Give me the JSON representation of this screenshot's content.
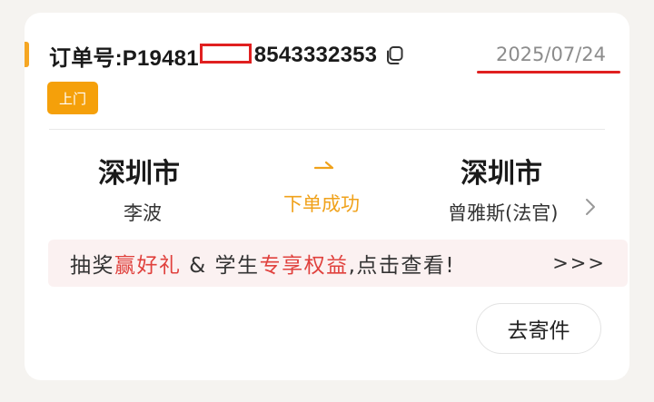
{
  "order": {
    "label_prefix": "订单号:P19481",
    "label_suffix": "8543332353",
    "date": "2025/07/24",
    "badge": "上门"
  },
  "route": {
    "origin_city": "深圳市",
    "origin_person": "李波",
    "status": "下单成功",
    "destination_city": "深圳市",
    "destination_person": "曾雅斯(法官)"
  },
  "promo": {
    "part1": "抽奖",
    "part2": "赢好礼",
    "part3": " & 学生",
    "part4": "专享权益",
    "part5": ",点击查看!",
    "more": ">>>"
  },
  "actions": {
    "go_send": "去寄件"
  },
  "colors": {
    "accent": "#f5a623",
    "status": "#f0a21b",
    "highlight": "#e0413d",
    "redaction": "#e02020"
  }
}
